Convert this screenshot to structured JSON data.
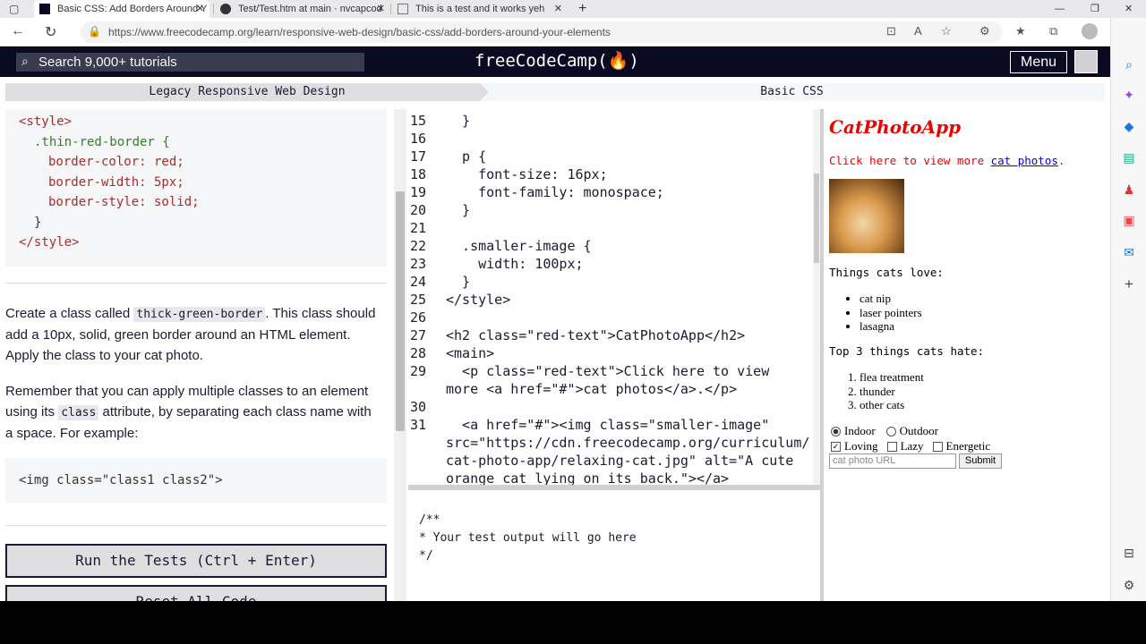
{
  "browser": {
    "tabs": [
      {
        "title": "Basic CSS: Add Borders Around Y"
      },
      {
        "title": "Test/Test.htm at main · nvcapcod"
      },
      {
        "title": "This is a test and it works yeh"
      }
    ],
    "url": "https://www.freecodecamp.org/learn/responsive-web-design/basic-css/add-borders-around-your-elements"
  },
  "fcc_nav": {
    "search_placeholder": "Search 9,000+ tutorials",
    "logo": "freeCodeCamp(🔥)",
    "menu_label": "Menu"
  },
  "breadcrumbs": {
    "superblock": "Legacy Responsive Web Design",
    "block": "Basic CSS"
  },
  "instructions": {
    "example_code": [
      "<style>",
      "  .thin-red-border {",
      "    border-color: red;",
      "    border-width: 5px;",
      "    border-style: solid;",
      "  }",
      "</style>"
    ],
    "para1_a": "Create a class called ",
    "para1_code": "thick-green-border",
    "para1_b": ". This class should add a 10px, solid, green border around an HTML element. Apply the class to your cat photo.",
    "para2_a": "Remember that you can apply multiple classes to an element using its ",
    "para2_code": "class",
    "para2_b": " attribute, by separating each class name with a space. For example:",
    "example2": "<img class=\"class1 class2\">",
    "run_button": "Run the Tests (Ctrl + Enter)",
    "reset_button": "Reset All Code"
  },
  "editor": {
    "lines": [
      {
        "n": "15",
        "code": "  }"
      },
      {
        "n": "16",
        "code": ""
      },
      {
        "n": "17",
        "code": "  p {"
      },
      {
        "n": "18",
        "code": "    font-size: 16px;"
      },
      {
        "n": "19",
        "code": "    font-family: monospace;"
      },
      {
        "n": "20",
        "code": "  }"
      },
      {
        "n": "21",
        "code": ""
      },
      {
        "n": "22",
        "code": "  .smaller-image {"
      },
      {
        "n": "23",
        "code": "    width: 100px;"
      },
      {
        "n": "24",
        "code": "  }"
      },
      {
        "n": "25",
        "code": "</style>"
      },
      {
        "n": "26",
        "code": ""
      },
      {
        "n": "27",
        "code": "<h2 class=\"red-text\">CatPhotoApp</h2>"
      },
      {
        "n": "28",
        "code": "<main>"
      },
      {
        "n": "29",
        "code": "  <p class=\"red-text\">Click here to view"
      },
      {
        "n": "",
        "code": "more <a href=\"#\">cat photos</a>.</p>"
      },
      {
        "n": "30",
        "code": ""
      },
      {
        "n": "31",
        "code": "  <a href=\"#\"><img class=\"smaller-image\""
      },
      {
        "n": "",
        "code": "src=\"https://cdn.freecodecamp.org/curriculum/"
      },
      {
        "n": "",
        "code": "cat-photo-app/relaxing-cat.jpg\" alt=\"A cute"
      },
      {
        "n": "",
        "code": "orange cat lying on its back.\"></a>"
      }
    ]
  },
  "console": {
    "text": "/**\n* Your test output will go here\n*/"
  },
  "preview": {
    "title": "CatPhotoApp",
    "click_a": "Click here to view more ",
    "click_link": "cat photos",
    "click_b": ".",
    "loves_heading": "Things cats love:",
    "loves": [
      "cat nip",
      "laser pointers",
      "lasagna"
    ],
    "hates_heading": "Top 3 things cats hate:",
    "hates": [
      "flea treatment",
      "thunder",
      "other cats"
    ],
    "radio_indoor": "Indoor",
    "radio_outdoor": "Outdoor",
    "check_loving": "Loving",
    "check_lazy": "Lazy",
    "check_energetic": "Energetic",
    "url_placeholder": "cat photo URL",
    "submit": "Submit"
  },
  "colors": {
    "fcc_nav": "#0a0a23",
    "preview_title": "#ee0000"
  }
}
